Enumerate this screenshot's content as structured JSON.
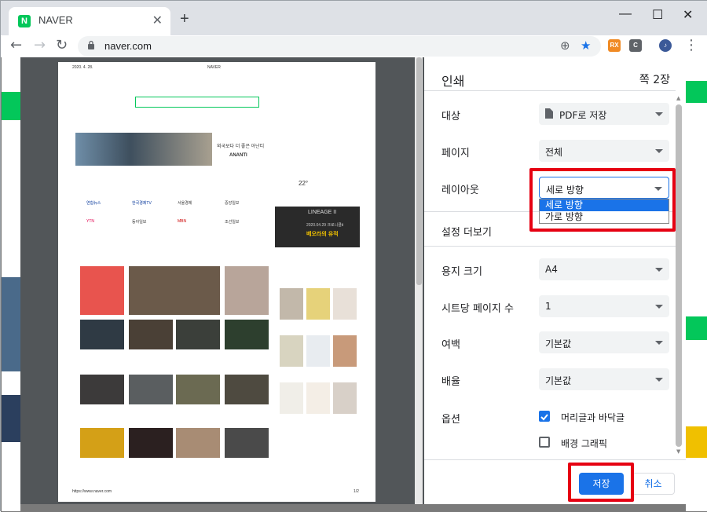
{
  "browser": {
    "tab_title": "NAVER",
    "tab_favicon_letter": "N",
    "url": "naver.com",
    "extensions": [
      "RX",
      "C"
    ]
  },
  "preview": {
    "date": "2020. 4. 28.",
    "site": "NAVER",
    "footer_url": "https://www.naver.com",
    "footer_page": "1/2",
    "ad_title": "외국보다 더 좋은 아난티",
    "ad_brand": "ANANTI",
    "weather_temp": "22°",
    "ad2_title": "LINEAGE II",
    "ad2_sub": "2020.04.29 크로니클Ⅱ",
    "ad2_line": "베오라의 유적",
    "press": [
      "연합뉴스",
      "한국경제TV",
      "서울경제",
      "중앙일보",
      "YTN",
      "동아일보",
      "MBN",
      "조선일보"
    ]
  },
  "panel": {
    "title": "인쇄",
    "page_count": "쪽 2장",
    "rows": {
      "destination": {
        "label": "대상",
        "value": "PDF로 저장"
      },
      "pages": {
        "label": "페이지",
        "value": "전체"
      },
      "layout": {
        "label": "레이아웃",
        "value": "세로 방향"
      },
      "more": {
        "label": "설정 더보기"
      },
      "paper": {
        "label": "용지 크기",
        "value": "A4"
      },
      "pps": {
        "label": "시트당 페이지 수",
        "value": "1"
      },
      "margins": {
        "label": "여백",
        "value": "기본값"
      },
      "scale": {
        "label": "배율",
        "value": "기본값"
      },
      "options": {
        "label": "옵션"
      }
    },
    "opt_headers": {
      "label": "머리글과 바닥글",
      "checked": true
    },
    "opt_background": {
      "label": "배경 그래픽",
      "checked": false
    },
    "dropdown_options": [
      "세로 방향",
      "가로 방향"
    ],
    "save_label": "저장",
    "cancel_label": "취소"
  },
  "colors": {
    "accent": "#1a73e8",
    "highlight": "#e60012",
    "naver_green": "#03c75a"
  }
}
